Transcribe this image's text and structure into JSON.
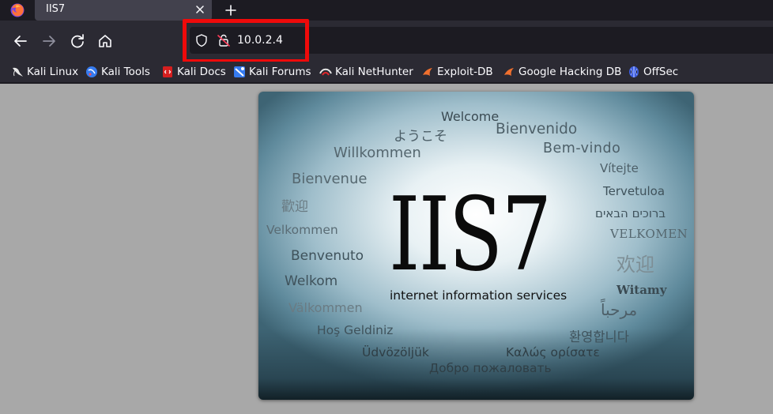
{
  "browser": {
    "tab": {
      "title": "IIS7"
    },
    "url": "10.0.2.4",
    "bookmarks": [
      {
        "label": "Kali Linux",
        "icon": "kali-dragon-icon"
      },
      {
        "label": "Kali Tools",
        "icon": "kali-tools-icon"
      },
      {
        "label": "Kali Docs",
        "icon": "kali-docs-icon"
      },
      {
        "label": "Kali Forums",
        "icon": "kali-forums-icon"
      },
      {
        "label": "Kali NetHunter",
        "icon": "nethunter-icon"
      },
      {
        "label": "Exploit-DB",
        "icon": "exploit-db-icon"
      },
      {
        "label": "Google Hacking DB",
        "icon": "ghdb-icon"
      },
      {
        "label": "OffSec",
        "icon": "offsec-icon"
      }
    ],
    "colors": {
      "tabstrip": "#1c1b22",
      "toolbar": "#2b2a33",
      "highlight": "#ef0a0a"
    }
  },
  "page": {
    "logo": "IIS7",
    "subtitle": "internet information services",
    "welcome_words": [
      "Welcome",
      "ようこそ",
      "Bienvenido",
      "Willkommen",
      "Bem-vindo",
      "Vítejte",
      "Bienvenue",
      "Tervetuloa",
      "歡迎",
      "ברוכים הבאים",
      "Velkommen",
      "VELKOMEN",
      "Benvenuto",
      "欢迎",
      "Welkom",
      "Witamy",
      "Välkommen",
      "مرحباً",
      "Hoş Geldiniz",
      "환영합니다",
      "Üdvözöljük",
      "Καλώς ορίσατε",
      "Добро пожаловать"
    ]
  }
}
